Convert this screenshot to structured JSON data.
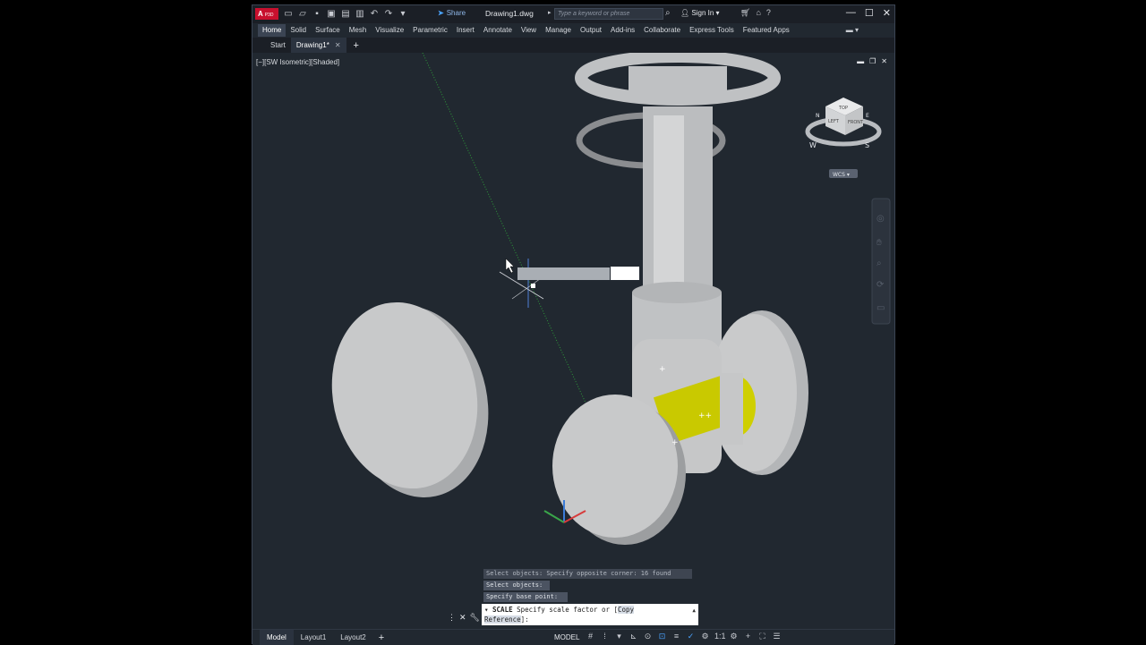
{
  "app": {
    "logo_text": "A",
    "logo_sub": "P3D",
    "share_label": "Share",
    "doc_title": "Drawing1.dwg",
    "search_placeholder": "Type a keyword or phrase",
    "sign_in": "Sign In"
  },
  "ribbon": {
    "tabs": [
      "Home",
      "Solid",
      "Surface",
      "Mesh",
      "Visualize",
      "Parametric",
      "Insert",
      "Annotate",
      "View",
      "Manage",
      "Output",
      "Add-ins",
      "Collaborate",
      "Express Tools",
      "Featured Apps"
    ],
    "active": "Home"
  },
  "file_tabs": {
    "start": "Start",
    "drawing": "Drawing1*"
  },
  "viewport": {
    "label": "[−][SW Isometric][Shaded]",
    "viewcube": {
      "top": "TOP",
      "left": "LEFT",
      "front": "FRONT",
      "compass_w": "W",
      "compass_s": "S",
      "compass_n": "N",
      "compass_e": "E"
    },
    "wcs": "WCS ▾"
  },
  "command": {
    "history1": "Select objects: Specify opposite corner: 16 found",
    "history2": "Select objects:",
    "history3": "Specify base point:",
    "prompt_cmd": "SCALE",
    "prompt_text": "Specify scale factor or [",
    "opt1": "Copy",
    "opt2": "Reference",
    "prompt_end": "]:"
  },
  "status": {
    "tabs": [
      "Model",
      "Layout1",
      "Layout2"
    ],
    "model_label": "MODEL",
    "scale": "1:1"
  },
  "colors": {
    "bg": "#212830",
    "valve_gray": "#c6c7c8",
    "yellow_part": "#d4d400",
    "accent": "#4aa3ff"
  }
}
